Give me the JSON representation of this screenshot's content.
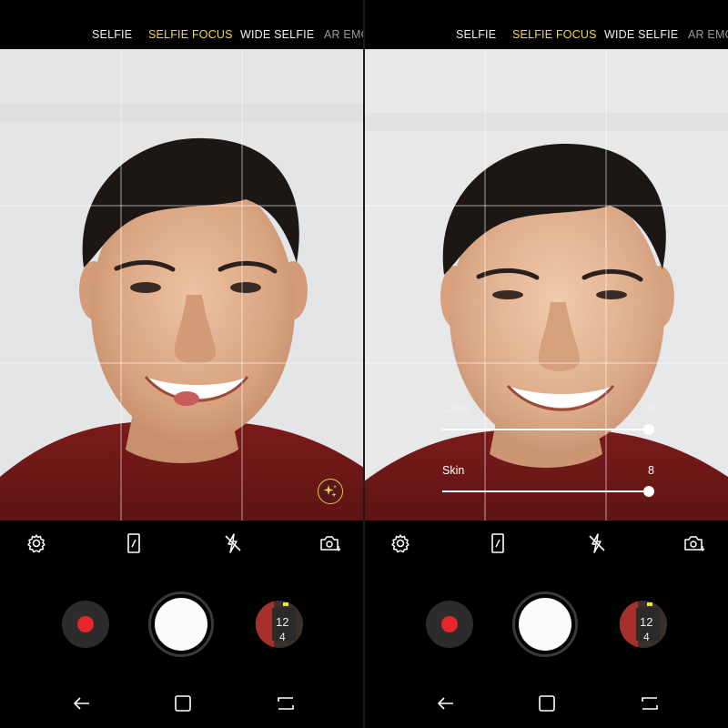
{
  "screens": [
    {
      "modes": [
        {
          "label": "SELFIE",
          "active": false
        },
        {
          "label": "SELFIE FOCUS",
          "active": true
        },
        {
          "label": "WIDE SELFIE",
          "active": false
        },
        {
          "label": "AR EMO",
          "active": false
        }
      ],
      "beauty_button": {
        "icon": "sparkle-icon",
        "visible": true
      },
      "sliders": []
    },
    {
      "modes": [
        {
          "label": "SELFIE",
          "active": false
        },
        {
          "label": "SELFIE FOCUS",
          "active": true
        },
        {
          "label": "WIDE SELFIE",
          "active": false
        },
        {
          "label": "AR EMO",
          "active": false
        }
      ],
      "beauty_button": {
        "visible": false
      },
      "sliders": [
        {
          "label": "Color",
          "value": "8",
          "level": 1.0,
          "dimmed": true
        },
        {
          "label": "Skin",
          "value": "8",
          "level": 1.0,
          "dimmed": false
        }
      ]
    }
  ],
  "toolbar": {
    "icons": [
      "settings-icon",
      "aspect-ratio-icon",
      "flash-off-icon",
      "switch-camera-icon"
    ]
  },
  "capture": {
    "record_icon": "record-icon",
    "shutter_icon": "shutter-button",
    "gallery_icon": "gallery-thumbnail"
  },
  "navigation": {
    "icons": [
      "back-icon",
      "home-icon",
      "recent-apps-icon"
    ]
  },
  "colors": {
    "active_mode": "#f1d84a",
    "record_red": "#e5262a",
    "shutter_white": "#fcfcfc",
    "shirt": "#701716",
    "wall": "#e4e6e8"
  }
}
